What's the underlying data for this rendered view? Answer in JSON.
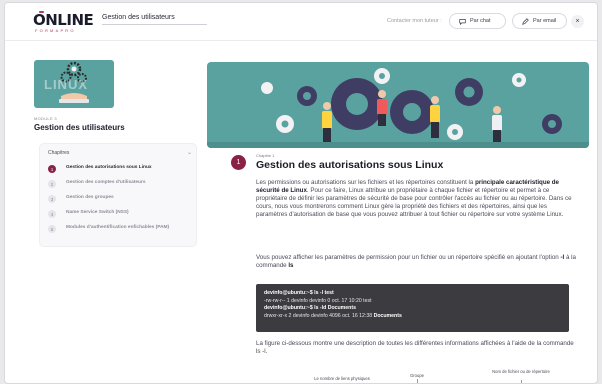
{
  "header": {
    "logo_text": "ONLINE",
    "logo_subtext": "FORMAPRO",
    "course_title": "Gestion des utilisateurs",
    "contact_text": "Contacter mon tuteur :",
    "chat_label": "Par chat",
    "email_label": "Par email",
    "close_label": "×"
  },
  "module": {
    "label": "MODULE 3",
    "title": "Gestion des utilisateurs",
    "thumbnail_text": "LINUX"
  },
  "chapters": {
    "heading": "Chapitres",
    "items": [
      {
        "num": "1",
        "label": "Gestion des autorisations sous Linux",
        "active": true
      },
      {
        "num": "2",
        "label": "Gestion des comptes d'utilisateurs",
        "active": false
      },
      {
        "num": "3",
        "label": "Gestion des groupes",
        "active": false
      },
      {
        "num": "4",
        "label": "Name Service Switch (NSS)",
        "active": false
      },
      {
        "num": "5",
        "label": "Modules d'authentification enfichables (PAM)",
        "active": false
      }
    ]
  },
  "content": {
    "chapter_num": "1",
    "chapter_label": "Chapitre 1",
    "chapter_title": "Gestion des autorisations sous Linux",
    "p1_before": "Les permissions ou autorisations sur les fichiers et les répertoires constituent la ",
    "p1_bold": "principale caractéristique de sécurité de Linux",
    "p1_after": ". Pour ce faire, Linux attribue un propriétaire à chaque fichier et répertoire et permet à ce propriétaire de définir les paramètres de sécurité de base pour contrôler l'accès au fichier ou au répertoire. Dans ce cours, nous vous montrerons comment Linux gère la propriété des fichiers et des répertoires, ainsi que les paramètres d'autorisation de base que vous pouvez attribuer à tout fichier ou répertoire sur votre système Linux.",
    "p2_before": "Vous pouvez afficher les paramètres de permission pour un fichier ou un répertoire spécifié en ajoutant l'option ",
    "p2_opt": "-l",
    "p2_mid": " à la commande ",
    "p2_cmd": "ls",
    "code": {
      "line1_prompt": "devinfo@ubuntu:~$",
      "line1_cmd": " ls -l test",
      "line2": "-rw-rw-r-- 1 devinfo devinfo 0 oct.   17 10:20 test",
      "line3_prompt": "devinfo@ubuntu:~$",
      "line3_cmd": " ls -ld Documents",
      "line4_text": "drwxr-xr-x 2 devinfo devinfo 4096 oct.   16 12:38 ",
      "line4_bold": "Documents"
    },
    "p3": "La figure ci-dessous montre une description de toutes les différentes informations affichées à l'aide de la commande ls -l.",
    "diagram": {
      "label_perms": "Le nombre de liens physiques",
      "label_group": "Groupe",
      "label_name": "Nom de fichier ou de répertoire"
    }
  },
  "colors": {
    "accent": "#8a2248",
    "hero_bg": "#5aa2a0",
    "code_bg": "#3c3c40"
  }
}
